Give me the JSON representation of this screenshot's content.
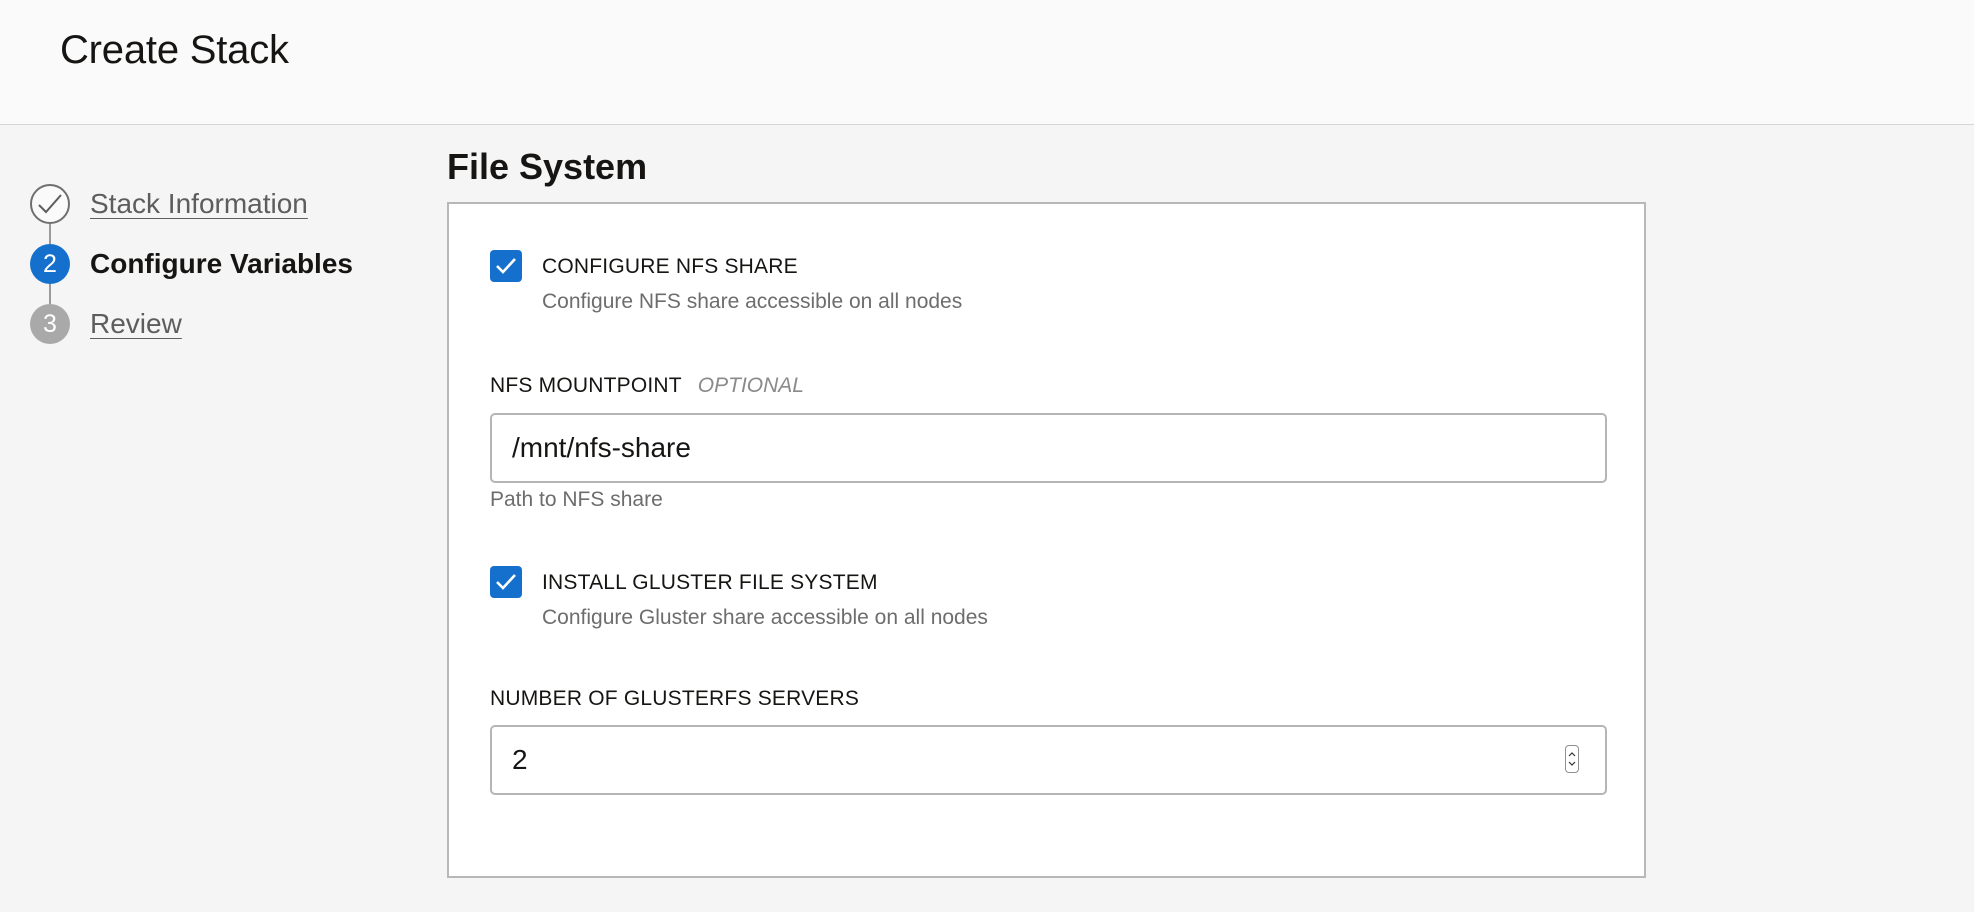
{
  "header": {
    "title": "Create Stack"
  },
  "steps": [
    {
      "number": "",
      "label": "Stack Information",
      "state": "completed"
    },
    {
      "number": "2",
      "label": "Configure Variables",
      "state": "current"
    },
    {
      "number": "3",
      "label": "Review",
      "state": "upcoming"
    }
  ],
  "section": {
    "title": "File System"
  },
  "form": {
    "configure_nfs": {
      "label": "CONFIGURE NFS SHARE",
      "help": "Configure NFS share accessible on all nodes",
      "checked": true
    },
    "nfs_mountpoint": {
      "label": "NFS MOUNTPOINT",
      "optional": "OPTIONAL",
      "value": "/mnt/nfs-share",
      "help": "Path to NFS share"
    },
    "install_gluster": {
      "label": "INSTALL GLUSTER FILE SYSTEM",
      "help": "Configure Gluster share accessible on all nodes",
      "checked": true
    },
    "glusterfs_servers": {
      "label": "NUMBER OF GLUSTERFS SERVERS",
      "value": "2"
    }
  },
  "colors": {
    "accent": "#1470cc",
    "background": "#f5f5f5",
    "panel_border": "#b8b8b8"
  }
}
